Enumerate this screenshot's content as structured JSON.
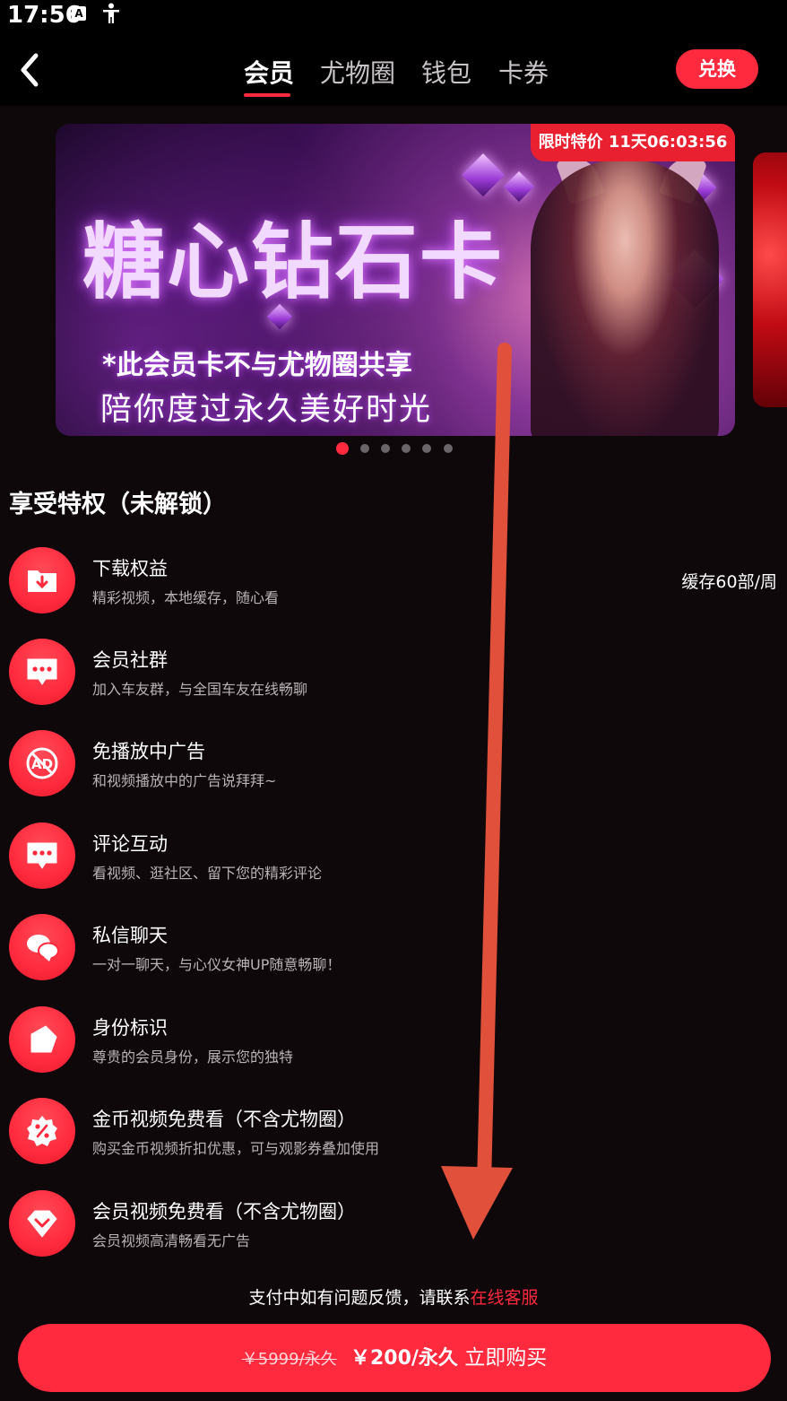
{
  "status_bar": {
    "time": "17:56",
    "icon_a": "A",
    "icons": [
      "a-badge-icon",
      "accessibility-icon"
    ]
  },
  "header": {
    "back_icon": "chevron-left-icon",
    "tabs": [
      {
        "label": "会员",
        "active": true
      },
      {
        "label": "尤物圈",
        "active": false
      },
      {
        "label": "钱包",
        "active": false
      },
      {
        "label": "卡券",
        "active": false
      }
    ],
    "redeem_label": "兑换"
  },
  "banner": {
    "badge": "限时特价 11天06:03:56",
    "title": "糖心钻石卡",
    "subtitle1": "*此会员卡不与尤物圈共享",
    "subtitle2": "陪你度过永久美好时光",
    "page_count": 6,
    "active_page": 1
  },
  "privileges": {
    "section_title": "享受特权（未解锁）",
    "items": [
      {
        "icon": "download-folder-icon",
        "title": "下载权益",
        "desc": "精彩视频，本地缓存，随心看",
        "right": "缓存60部/周"
      },
      {
        "icon": "chat-bubble-icon",
        "title": "会员社群",
        "desc": "加入车友群，与全国车友在线畅聊"
      },
      {
        "icon": "no-ad-icon",
        "title": "免播放中广告",
        "desc": "和视频播放中的广告说拜拜~"
      },
      {
        "icon": "comment-icon",
        "title": "评论互动",
        "desc": "看视频、逛社区、留下您的精彩评论"
      },
      {
        "icon": "private-chat-icon",
        "title": "私信聊天",
        "desc": "一对一聊天，与心仪女神UP随意畅聊！"
      },
      {
        "icon": "identity-badge-icon",
        "title": "身份标识",
        "desc": "尊贵的会员身份，展示您的独特"
      },
      {
        "icon": "discount-icon",
        "title": "金币视频免费看（不含尤物圈）",
        "desc": "购买金币视频折扣优惠，可与观影券叠加使用"
      },
      {
        "icon": "diamond-icon",
        "title": "会员视频免费看（不含尤物圈）",
        "desc": "会员视频高清畅看无广告"
      }
    ]
  },
  "contact": {
    "text": "支付中如有问题反馈，请联系",
    "link": "在线客服"
  },
  "purchase": {
    "old_price": "￥5999/永久",
    "new_price": "￥200/永久",
    "action": "立即购买"
  },
  "colors": {
    "accent": "#ff2a3d",
    "background": "#0e080b",
    "overlay_arrow": "#e0503a"
  }
}
